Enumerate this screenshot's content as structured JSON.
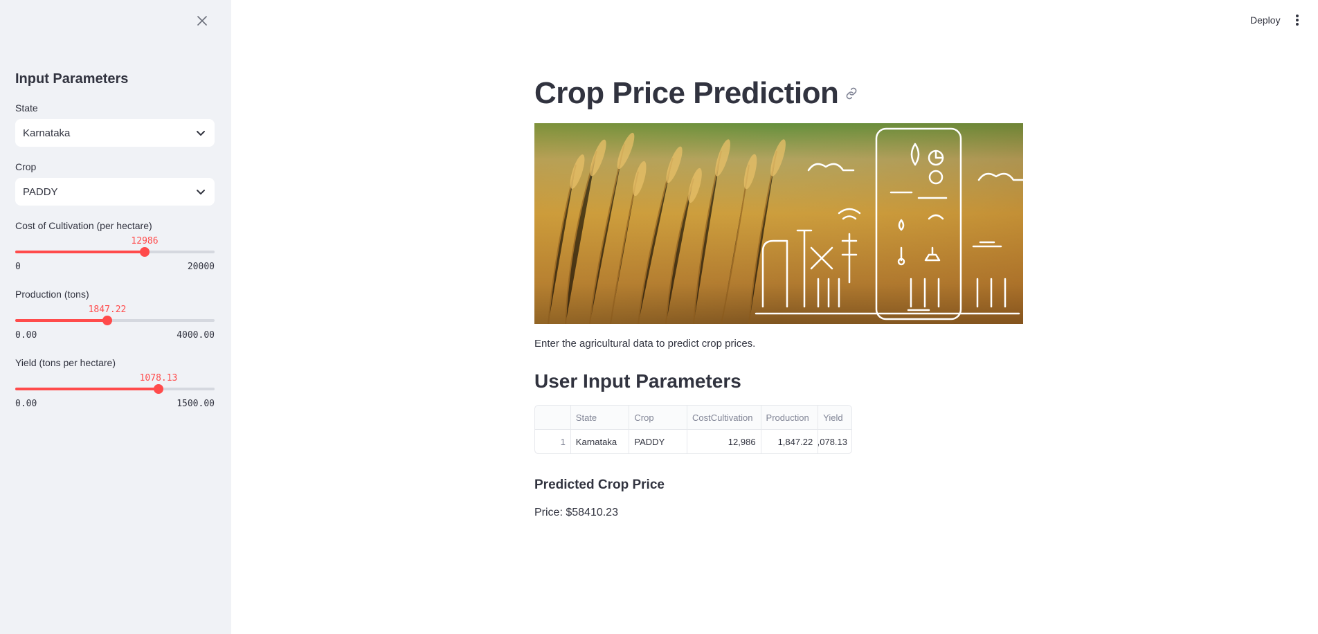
{
  "header": {
    "deploy_label": "Deploy",
    "menu_icon": "more-vertical-icon"
  },
  "sidebar": {
    "close_icon": "close-icon",
    "title": "Input Parameters",
    "state": {
      "label": "State",
      "value": "Karnataka"
    },
    "crop": {
      "label": "Crop",
      "value": "PADDY"
    },
    "cost_slider": {
      "label": "Cost of Cultivation (per hectare)",
      "value": "12986",
      "min": "0",
      "max": "20000",
      "fraction": 0.6493
    },
    "production_slider": {
      "label": "Production (tons)",
      "value": "1847.22",
      "min": "0.00",
      "max": "4000.00",
      "fraction": 0.4618
    },
    "yield_slider": {
      "label": "Yield (tons per hectare)",
      "value": "1078.13",
      "min": "0.00",
      "max": "1500.00",
      "fraction": 0.7188
    },
    "accent_color": "#ff4b4b"
  },
  "main": {
    "title": "Crop Price Prediction",
    "intro": "Enter the agricultural data to predict crop prices.",
    "input_section_title": "User Input Parameters",
    "table": {
      "columns": [
        "",
        "State",
        "Crop",
        "CostCultivation",
        "Production",
        "Yield"
      ],
      "rows": [
        [
          "1",
          "Karnataka",
          "PADDY",
          "12,986",
          "1,847.22",
          ",078.13"
        ]
      ]
    },
    "prediction_title": "Predicted Crop Price",
    "price_text": "Price: $58410.23"
  }
}
